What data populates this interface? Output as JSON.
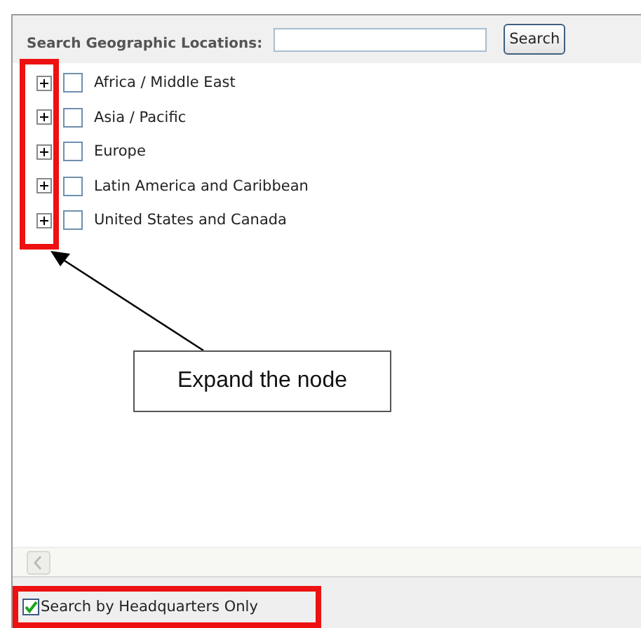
{
  "search": {
    "label": "Search Geographic Locations:",
    "button": "Search"
  },
  "tree": [
    {
      "label": "Africa / Middle East",
      "expanded": false,
      "checked": false
    },
    {
      "label": "Asia / Pacific",
      "expanded": false,
      "checked": false
    },
    {
      "label": "Europe",
      "expanded": false,
      "checked": false
    },
    {
      "label": "Latin America and Caribbean",
      "expanded": false,
      "checked": false
    },
    {
      "label": "United States and Canada",
      "expanded": false,
      "checked": false
    }
  ],
  "headquarters_only": {
    "label": "Search by Headquarters Only",
    "checked": true
  },
  "callout": "Expand the node"
}
